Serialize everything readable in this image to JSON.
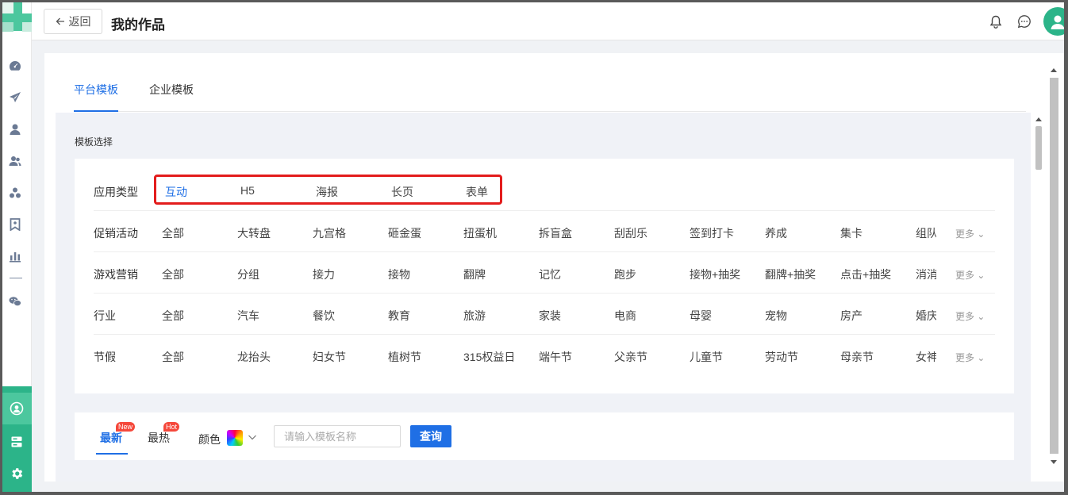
{
  "header": {
    "back_label": "返回",
    "title": "我的作品",
    "icons": [
      "arrow-left-icon",
      "bell-icon",
      "chat-icon",
      "user-avatar-icon"
    ]
  },
  "sidebar": {
    "icons": [
      "dashboard-icon",
      "send-icon",
      "user-icon",
      "users-icon",
      "cluster-icon",
      "bookmark-icon",
      "bar-chart-icon",
      "wechat-icon"
    ],
    "bottom_icons": [
      "works-icon",
      "server-icon",
      "settings-icon"
    ]
  },
  "tabs": [
    {
      "label": "平台模板",
      "active": true
    },
    {
      "label": "企业模板",
      "active": false
    }
  ],
  "section_label": "模板选择",
  "filters": {
    "app_type": {
      "label": "应用类型",
      "options": [
        "互动",
        "H5",
        "海报",
        "长页",
        "表单"
      ],
      "active_index": 0
    },
    "rows": [
      {
        "label": "促销活动",
        "options": [
          "全部",
          "大转盘",
          "九宫格",
          "砸金蛋",
          "扭蛋机",
          "拆盲盒",
          "刮刮乐",
          "签到打卡",
          "养成",
          "集卡",
          "组队"
        ],
        "more": "更多"
      },
      {
        "label": "游戏营销",
        "options": [
          "全部",
          "分组",
          "接力",
          "接物",
          "翻牌",
          "记忆",
          "跑步",
          "接物+抽奖",
          "翻牌+抽奖",
          "点击+抽奖",
          "消消"
        ],
        "more": "更多"
      },
      {
        "label": "行业",
        "options": [
          "全部",
          "汽车",
          "餐饮",
          "教育",
          "旅游",
          "家装",
          "电商",
          "母婴",
          "宠物",
          "房产",
          "婚庆"
        ],
        "more": "更多"
      },
      {
        "label": "节假",
        "options": [
          "全部",
          "龙抬头",
          "妇女节",
          "植树节",
          "315权益日",
          "端午节",
          "父亲节",
          "儿童节",
          "劳动节",
          "母亲节",
          "女神"
        ],
        "more": "更多"
      }
    ]
  },
  "search": {
    "sort_tabs": [
      {
        "label": "最新",
        "badge": "New",
        "active": true
      },
      {
        "label": "最热",
        "badge": "Hot",
        "active": false
      }
    ],
    "color_label": "颜色",
    "placeholder": "请输入模板名称",
    "value": "",
    "query_label": "查询"
  },
  "colors": {
    "accent": "#1f6fe5",
    "sidebar_green": "#2cb489",
    "highlight_red": "#e31c1c",
    "badge_red": "#f5483b"
  }
}
